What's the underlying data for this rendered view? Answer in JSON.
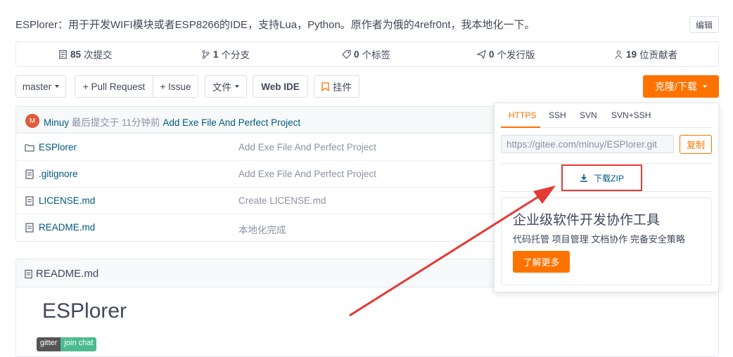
{
  "description": "ESPlorer：用于开发WIFI模块或者ESP8266的IDE，支持Lua，Python。原作者为俄的4refr0nt，我本地化一下。",
  "edit_label": "编辑",
  "stats": {
    "commits": {
      "count": "85",
      "label": "次提交"
    },
    "branches": {
      "count": "1",
      "label": "个分支"
    },
    "tags": {
      "count": "0",
      "label": "个标签"
    },
    "releases": {
      "count": "0",
      "label": "个发行版"
    },
    "contributors": {
      "count": "19",
      "label": "位贡献者"
    }
  },
  "toolbar": {
    "branch": "master",
    "pull_request": "+ Pull Request",
    "issue": "+ Issue",
    "files": "文件",
    "web_ide": "Web IDE",
    "widget": "挂件",
    "clone": "克隆/下载"
  },
  "commit": {
    "avatar_letter": "M",
    "author": "Minuy",
    "label": "最后提交于",
    "time": "11分钟前",
    "message": "Add Exe File And Perfect Project"
  },
  "files": [
    {
      "name": "ESPlorer",
      "message": "Add Exe File And Perfect Project",
      "icon": "folder-icon"
    },
    {
      "name": ".gitignore",
      "message": "Add Exe File And Perfect Project",
      "icon": "file-icon"
    },
    {
      "name": "LICENSE.md",
      "message": "Create LICENSE.md",
      "icon": "file-icon"
    },
    {
      "name": "README.md",
      "message": "本地化完成",
      "icon": "file-icon"
    }
  ],
  "readme": {
    "file": "README.md",
    "heading": "ESPlorer",
    "badge_left": "gitter",
    "badge_right": "join chat"
  },
  "clone_dropdown": {
    "tabs": [
      "HTTPS",
      "SSH",
      "SVN",
      "SVN+SSH"
    ],
    "active_tab": "HTTPS",
    "url": "https://gitee.com/minuy/ESPlorer.git",
    "copy_label": "复制",
    "download_zip": "下载ZIP",
    "promo_title": "企业级软件开发协作工具",
    "promo_sub": "代码托管 项目管理 文档协作 完备安全策略",
    "promo_button": "了解更多"
  },
  "colors": {
    "accent": "#fe7300",
    "link": "#005980",
    "annotation": "#e53935"
  }
}
